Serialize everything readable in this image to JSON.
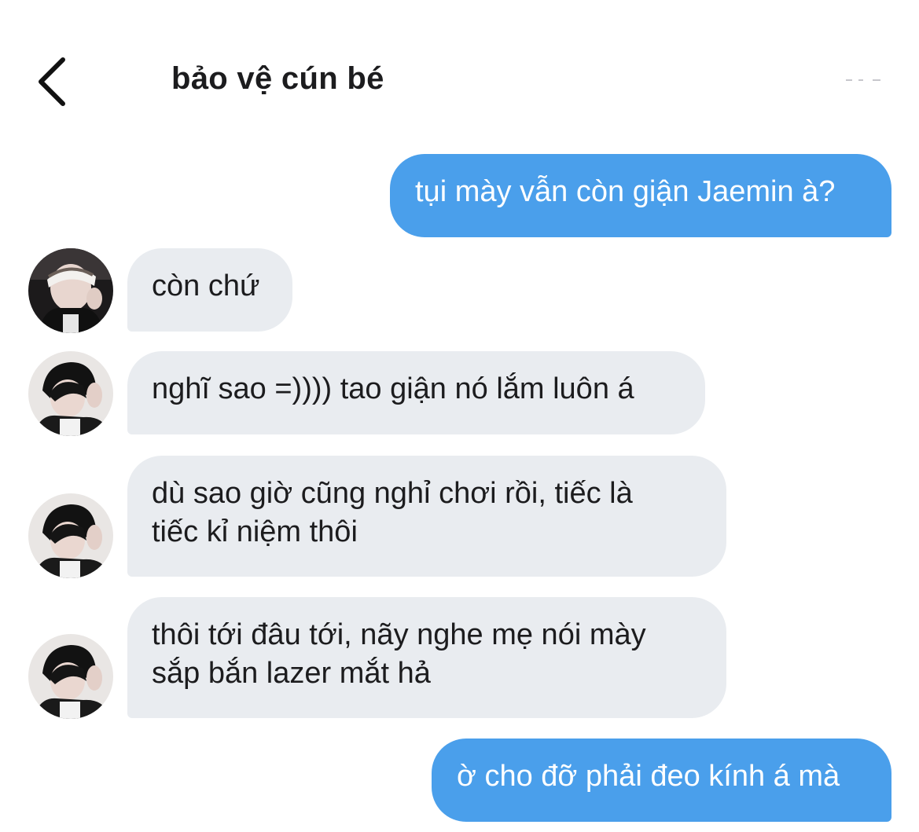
{
  "header": {
    "title": "bảo vệ cún bé"
  },
  "colors": {
    "outgoing_bubble": "#4a9feb",
    "incoming_bubble": "#e9ecf0",
    "text_dark": "#1c1c1e",
    "text_light": "#ffffff"
  },
  "messages": [
    {
      "direction": "outgoing",
      "lines": [
        "tụi mày vẫn còn giận Jaemin à?"
      ]
    },
    {
      "direction": "incoming",
      "avatar": "avatar-photo-1",
      "lines": [
        "còn chứ"
      ]
    },
    {
      "direction": "incoming",
      "avatar": "avatar-photo-2",
      "lines": [
        "nghĩ sao =)))) tao giận nó lắm luôn á"
      ]
    },
    {
      "direction": "incoming",
      "avatar": "avatar-photo-2",
      "lines": [
        "dù sao giờ cũng nghỉ chơi rồi, tiếc là",
        "tiếc kỉ niệm thôi"
      ]
    },
    {
      "direction": "incoming",
      "avatar": "avatar-photo-2",
      "lines": [
        "thôi tới đâu tới, nãy nghe mẹ nói mày",
        "sắp bắn lazer mắt hả"
      ]
    },
    {
      "direction": "outgoing",
      "lines": [
        "ờ cho đỡ phải đeo kính á mà"
      ]
    }
  ]
}
